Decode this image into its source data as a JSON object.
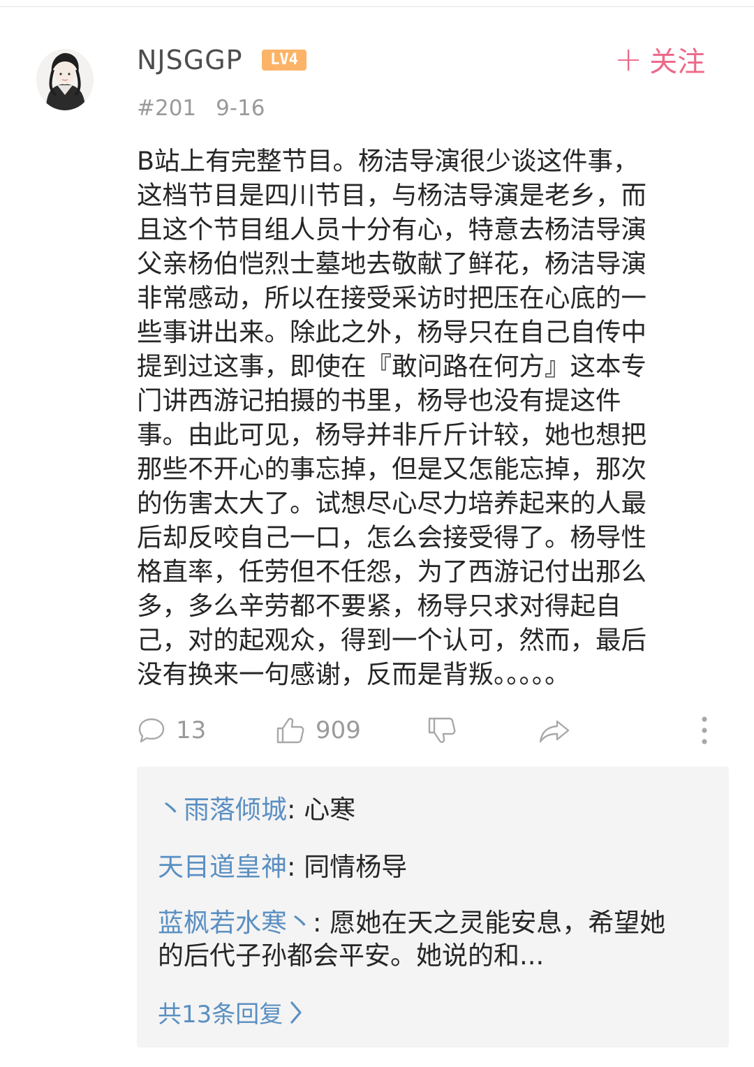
{
  "post": {
    "username": "NJSGGP",
    "level": "LV4",
    "follow_label": "关注",
    "floor": "#201",
    "date": "9-16",
    "body": "B站上有完整节目。杨洁导演很少谈这件事，\n这档节目是四川节目，与杨洁导演是老乡，而\n且这个节目组人员十分有心，特意去杨洁导演\n父亲杨伯恺烈士墓地去敬献了鲜花，杨洁导演\n非常感动，所以在接受采访时把压在心底的一\n些事讲出来。除此之外，杨导只在自己自传中\n提到过这事，即使在『敢问路在何方』这本专\n门讲西游记拍摄的书里，杨导也没有提这件\n事。由此可见，杨导并非斤斤计较，她也想把\n那些不开心的事忘掉，但是又怎能忘掉，那次\n的伤害太大了。试想尽心尽力培养起来的人最\n后却反咬自己一口，怎么会接受得了。杨导性\n格直率，任劳但不任怨，为了西游记付出那么\n多，多么辛劳都不要紧，杨导只求对得起自\n己，对的起观众，得到一个认可，然而，最后\n没有换来一句感谢，反而是背叛。。。。。"
  },
  "actions": {
    "comments": "13",
    "likes": "909"
  },
  "replies": [
    {
      "author": "丶雨落倾城",
      "text": ": 心寒"
    },
    {
      "author": "天目道皇神",
      "text": ": 同情杨导"
    },
    {
      "author": "蓝枫若水寒丶",
      "text": ": 愿她在天之灵能安息，希望她的后代子孙都会平安。她说的和..."
    }
  ],
  "more_replies_label": "共13条回复",
  "colors": {
    "accent": "#ec6a8a",
    "link": "#5a8fc2",
    "level_badge": "#fbb467"
  }
}
